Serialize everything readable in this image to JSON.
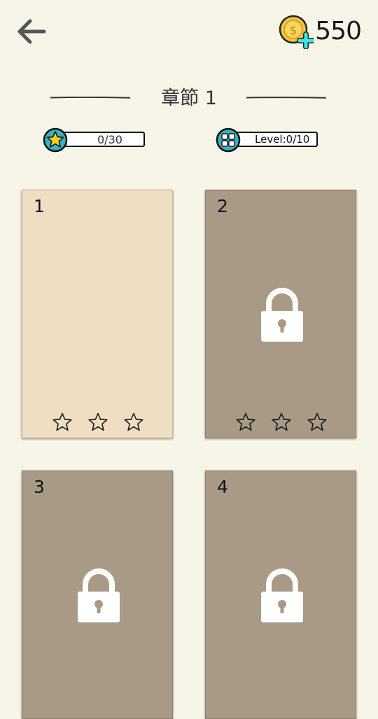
{
  "header": {
    "back_icon": "arrow-left-icon",
    "coin_icon": "coin-plus-icon",
    "coins": "550"
  },
  "chapter": {
    "title": "章節 1"
  },
  "progress": {
    "stars": "0/30",
    "levels": "Level:0/10"
  },
  "colors": {
    "background": "#f7f5e8",
    "unlocked_card": "#efdec2",
    "locked_card": "#a89a86",
    "badge_teal": "#35b3c6",
    "star_yellow": "#f7d21e",
    "coin_gold": "#f5c542"
  },
  "levels": [
    {
      "number": "1",
      "locked": false,
      "stars_earned": 0,
      "stars_total": 3
    },
    {
      "number": "2",
      "locked": true,
      "stars_earned": 0,
      "stars_total": 3
    },
    {
      "number": "3",
      "locked": true
    },
    {
      "number": "4",
      "locked": true
    }
  ]
}
